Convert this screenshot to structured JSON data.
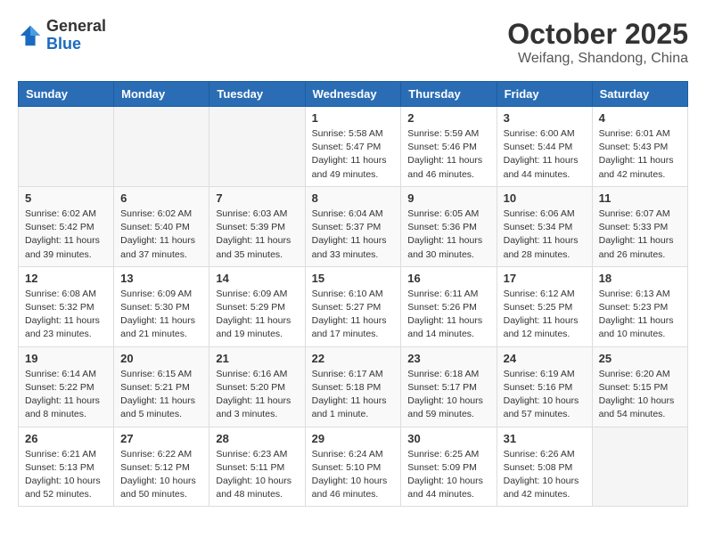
{
  "logo": {
    "general": "General",
    "blue": "Blue"
  },
  "title": "October 2025",
  "location": "Weifang, Shandong, China",
  "weekdays": [
    "Sunday",
    "Monday",
    "Tuesday",
    "Wednesday",
    "Thursday",
    "Friday",
    "Saturday"
  ],
  "weeks": [
    [
      {
        "day": "",
        "info": ""
      },
      {
        "day": "",
        "info": ""
      },
      {
        "day": "",
        "info": ""
      },
      {
        "day": "1",
        "info": "Sunrise: 5:58 AM\nSunset: 5:47 PM\nDaylight: 11 hours and 49 minutes."
      },
      {
        "day": "2",
        "info": "Sunrise: 5:59 AM\nSunset: 5:46 PM\nDaylight: 11 hours and 46 minutes."
      },
      {
        "day": "3",
        "info": "Sunrise: 6:00 AM\nSunset: 5:44 PM\nDaylight: 11 hours and 44 minutes."
      },
      {
        "day": "4",
        "info": "Sunrise: 6:01 AM\nSunset: 5:43 PM\nDaylight: 11 hours and 42 minutes."
      }
    ],
    [
      {
        "day": "5",
        "info": "Sunrise: 6:02 AM\nSunset: 5:42 PM\nDaylight: 11 hours and 39 minutes."
      },
      {
        "day": "6",
        "info": "Sunrise: 6:02 AM\nSunset: 5:40 PM\nDaylight: 11 hours and 37 minutes."
      },
      {
        "day": "7",
        "info": "Sunrise: 6:03 AM\nSunset: 5:39 PM\nDaylight: 11 hours and 35 minutes."
      },
      {
        "day": "8",
        "info": "Sunrise: 6:04 AM\nSunset: 5:37 PM\nDaylight: 11 hours and 33 minutes."
      },
      {
        "day": "9",
        "info": "Sunrise: 6:05 AM\nSunset: 5:36 PM\nDaylight: 11 hours and 30 minutes."
      },
      {
        "day": "10",
        "info": "Sunrise: 6:06 AM\nSunset: 5:34 PM\nDaylight: 11 hours and 28 minutes."
      },
      {
        "day": "11",
        "info": "Sunrise: 6:07 AM\nSunset: 5:33 PM\nDaylight: 11 hours and 26 minutes."
      }
    ],
    [
      {
        "day": "12",
        "info": "Sunrise: 6:08 AM\nSunset: 5:32 PM\nDaylight: 11 hours and 23 minutes."
      },
      {
        "day": "13",
        "info": "Sunrise: 6:09 AM\nSunset: 5:30 PM\nDaylight: 11 hours and 21 minutes."
      },
      {
        "day": "14",
        "info": "Sunrise: 6:09 AM\nSunset: 5:29 PM\nDaylight: 11 hours and 19 minutes."
      },
      {
        "day": "15",
        "info": "Sunrise: 6:10 AM\nSunset: 5:27 PM\nDaylight: 11 hours and 17 minutes."
      },
      {
        "day": "16",
        "info": "Sunrise: 6:11 AM\nSunset: 5:26 PM\nDaylight: 11 hours and 14 minutes."
      },
      {
        "day": "17",
        "info": "Sunrise: 6:12 AM\nSunset: 5:25 PM\nDaylight: 11 hours and 12 minutes."
      },
      {
        "day": "18",
        "info": "Sunrise: 6:13 AM\nSunset: 5:23 PM\nDaylight: 11 hours and 10 minutes."
      }
    ],
    [
      {
        "day": "19",
        "info": "Sunrise: 6:14 AM\nSunset: 5:22 PM\nDaylight: 11 hours and 8 minutes."
      },
      {
        "day": "20",
        "info": "Sunrise: 6:15 AM\nSunset: 5:21 PM\nDaylight: 11 hours and 5 minutes."
      },
      {
        "day": "21",
        "info": "Sunrise: 6:16 AM\nSunset: 5:20 PM\nDaylight: 11 hours and 3 minutes."
      },
      {
        "day": "22",
        "info": "Sunrise: 6:17 AM\nSunset: 5:18 PM\nDaylight: 11 hours and 1 minute."
      },
      {
        "day": "23",
        "info": "Sunrise: 6:18 AM\nSunset: 5:17 PM\nDaylight: 10 hours and 59 minutes."
      },
      {
        "day": "24",
        "info": "Sunrise: 6:19 AM\nSunset: 5:16 PM\nDaylight: 10 hours and 57 minutes."
      },
      {
        "day": "25",
        "info": "Sunrise: 6:20 AM\nSunset: 5:15 PM\nDaylight: 10 hours and 54 minutes."
      }
    ],
    [
      {
        "day": "26",
        "info": "Sunrise: 6:21 AM\nSunset: 5:13 PM\nDaylight: 10 hours and 52 minutes."
      },
      {
        "day": "27",
        "info": "Sunrise: 6:22 AM\nSunset: 5:12 PM\nDaylight: 10 hours and 50 minutes."
      },
      {
        "day": "28",
        "info": "Sunrise: 6:23 AM\nSunset: 5:11 PM\nDaylight: 10 hours and 48 minutes."
      },
      {
        "day": "29",
        "info": "Sunrise: 6:24 AM\nSunset: 5:10 PM\nDaylight: 10 hours and 46 minutes."
      },
      {
        "day": "30",
        "info": "Sunrise: 6:25 AM\nSunset: 5:09 PM\nDaylight: 10 hours and 44 minutes."
      },
      {
        "day": "31",
        "info": "Sunrise: 6:26 AM\nSunset: 5:08 PM\nDaylight: 10 hours and 42 minutes."
      },
      {
        "day": "",
        "info": ""
      }
    ]
  ]
}
